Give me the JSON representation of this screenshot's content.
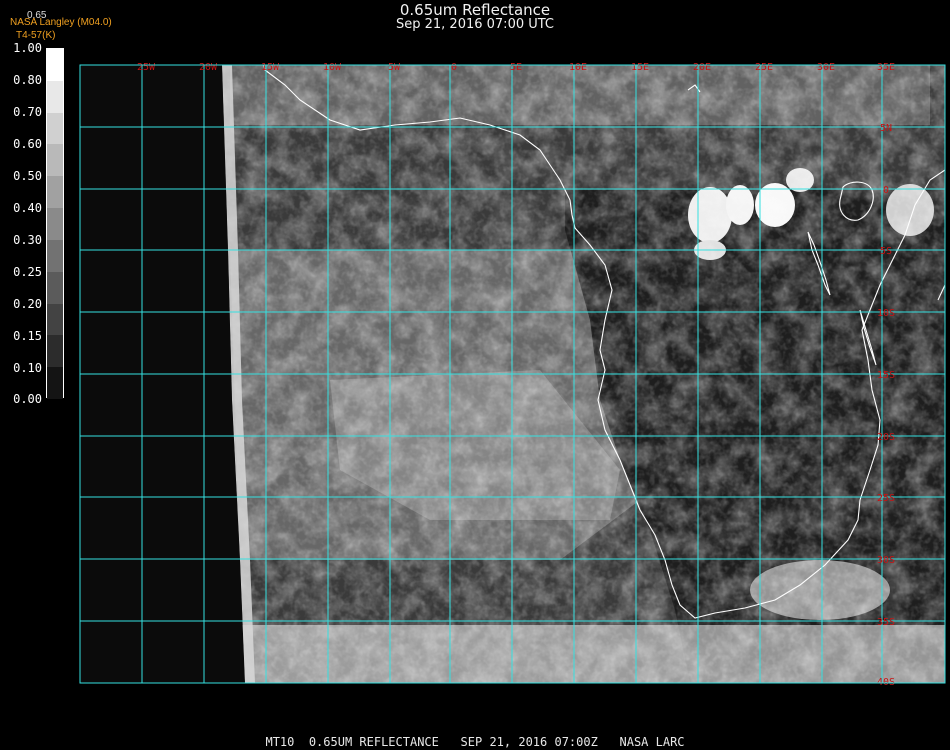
{
  "header": {
    "title": "0.65um Reflectance",
    "subtitle": "Sep 21, 2016 07:00 UTC",
    "credit": "NASA Langley (M04.0)",
    "credit2": "T4-57(K)",
    "scale_top": "0.65"
  },
  "colorbar": {
    "labels": [
      "1.00",
      "0.80",
      "0.70",
      "0.60",
      "0.50",
      "0.40",
      "0.30",
      "0.25",
      "0.20",
      "0.15",
      "0.10",
      "0.00"
    ]
  },
  "map": {
    "lon_labels": [
      "25W",
      "20W",
      "15W",
      "10W",
      "5W",
      "0",
      "5E",
      "10E",
      "15E",
      "20E",
      "25E",
      "30E",
      "35E"
    ],
    "lat_labels": [
      "5N",
      "0",
      "5S",
      "10S",
      "15S",
      "20S",
      "25S",
      "30S",
      "35S",
      "40S"
    ],
    "grid_color": "#35e0e0",
    "label_color": "#c81414",
    "coast_color": "#ffffff"
  },
  "footer": {
    "text": "MT10  0.65UM REFLECTANCE   SEP 21, 2016 07:00Z   NASA LARC"
  }
}
